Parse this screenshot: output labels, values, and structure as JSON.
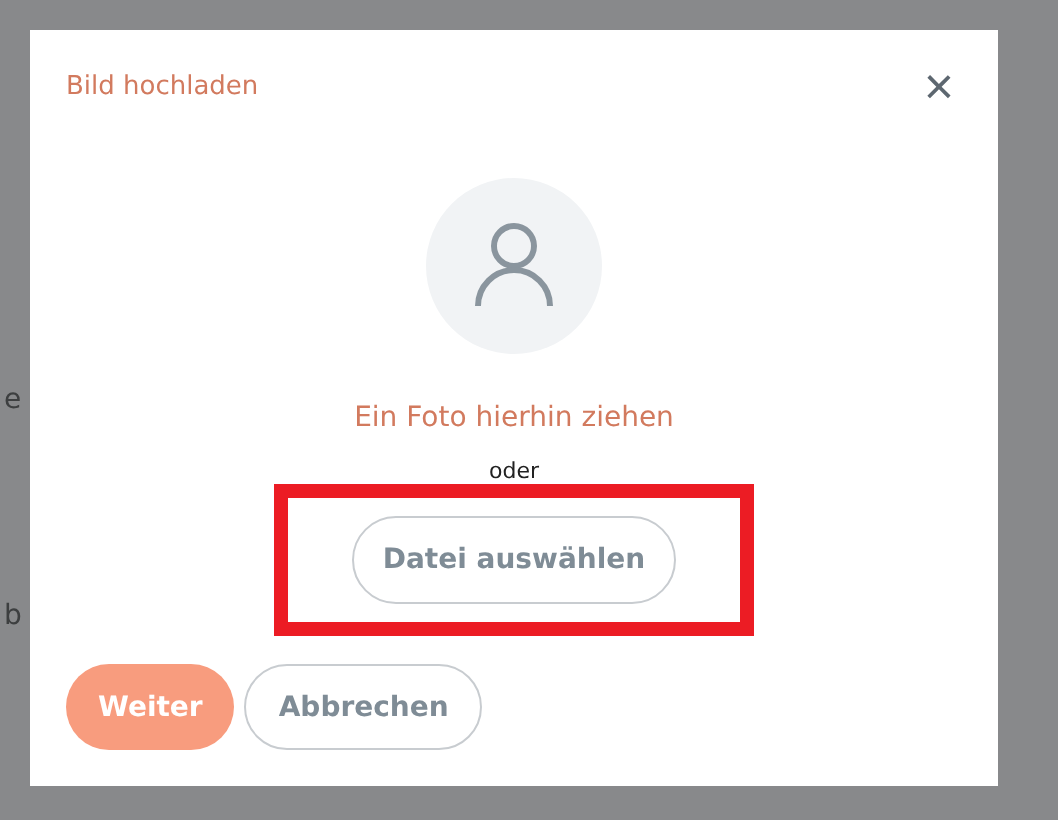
{
  "background_fragments": [
    "e",
    "b"
  ],
  "dialog": {
    "title": "Bild hochladen",
    "close": "×",
    "dropzone": {
      "prompt": "Ein Foto hierhin ziehen",
      "separator": "oder",
      "choose_button": {
        "label": "Datei auswählen",
        "highlighted": true
      }
    },
    "buttons": [
      {
        "label": "Weiter",
        "kind": "primary"
      },
      {
        "label": "Abbrechen",
        "kind": "secondary"
      }
    ]
  }
}
